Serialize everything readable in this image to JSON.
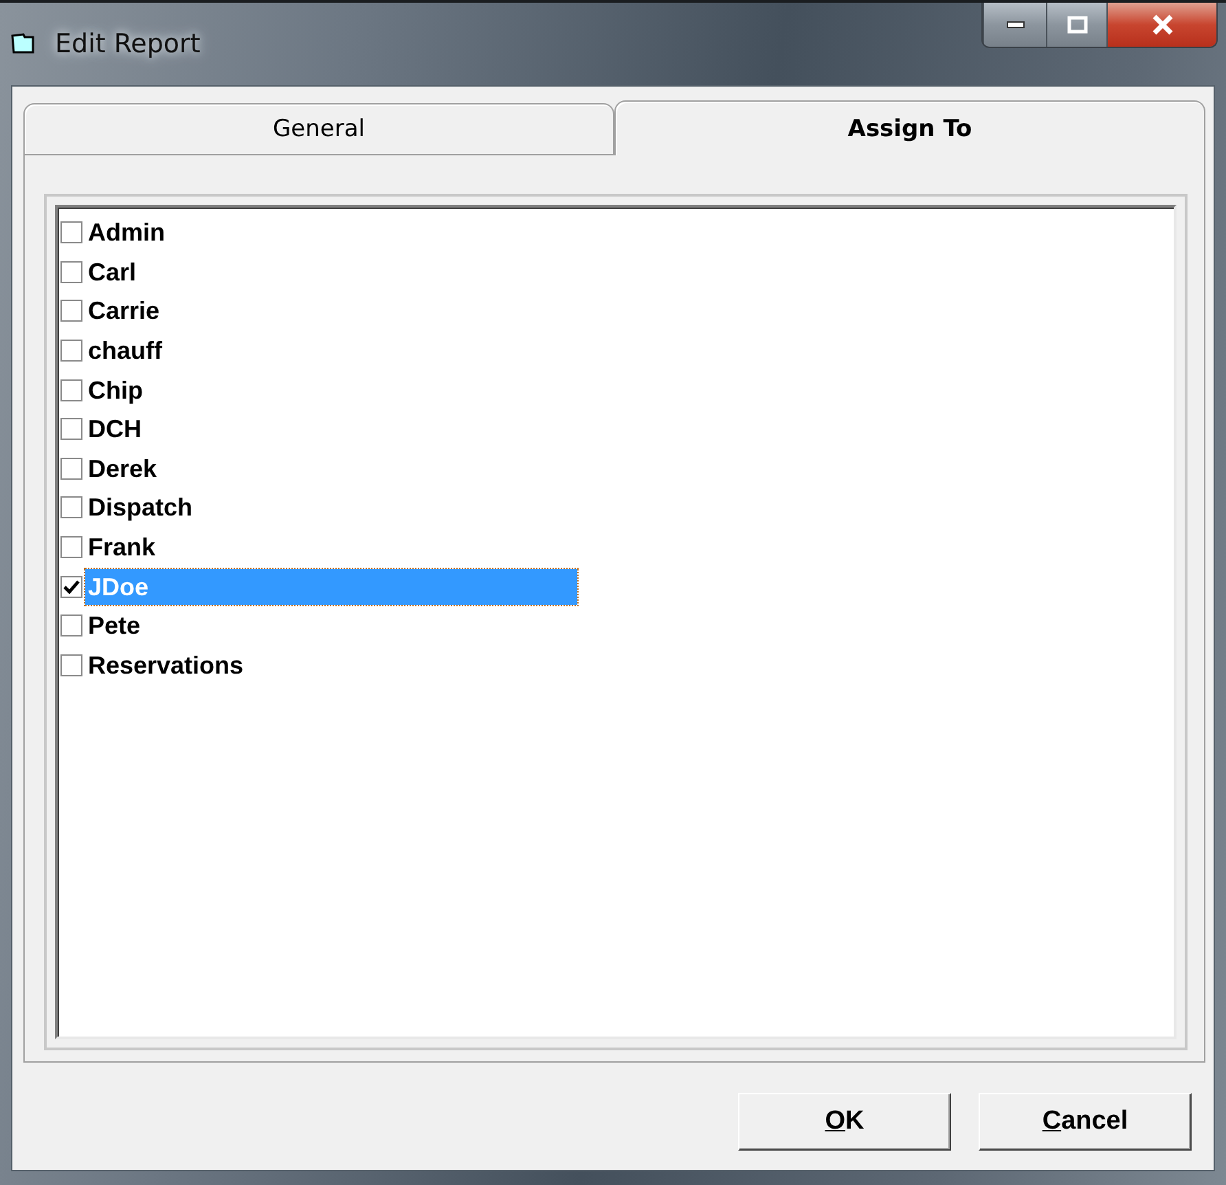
{
  "window": {
    "title": "Edit Report"
  },
  "tabs": [
    {
      "label": "General",
      "selected": false
    },
    {
      "label": "Assign To",
      "selected": true
    }
  ],
  "users": [
    {
      "name": "Admin",
      "checked": false,
      "selected": false
    },
    {
      "name": "Carl",
      "checked": false,
      "selected": false
    },
    {
      "name": "Carrie",
      "checked": false,
      "selected": false
    },
    {
      "name": "chauff",
      "checked": false,
      "selected": false
    },
    {
      "name": "Chip",
      "checked": false,
      "selected": false
    },
    {
      "name": "DCH",
      "checked": false,
      "selected": false
    },
    {
      "name": "Derek",
      "checked": false,
      "selected": false
    },
    {
      "name": "Dispatch",
      "checked": false,
      "selected": false
    },
    {
      "name": "Frank",
      "checked": false,
      "selected": false
    },
    {
      "name": "JDoe",
      "checked": true,
      "selected": true
    },
    {
      "name": "Pete",
      "checked": false,
      "selected": false
    },
    {
      "name": "Reservations",
      "checked": false,
      "selected": false
    }
  ],
  "buttons": [
    "OK",
    "Cancel"
  ]
}
